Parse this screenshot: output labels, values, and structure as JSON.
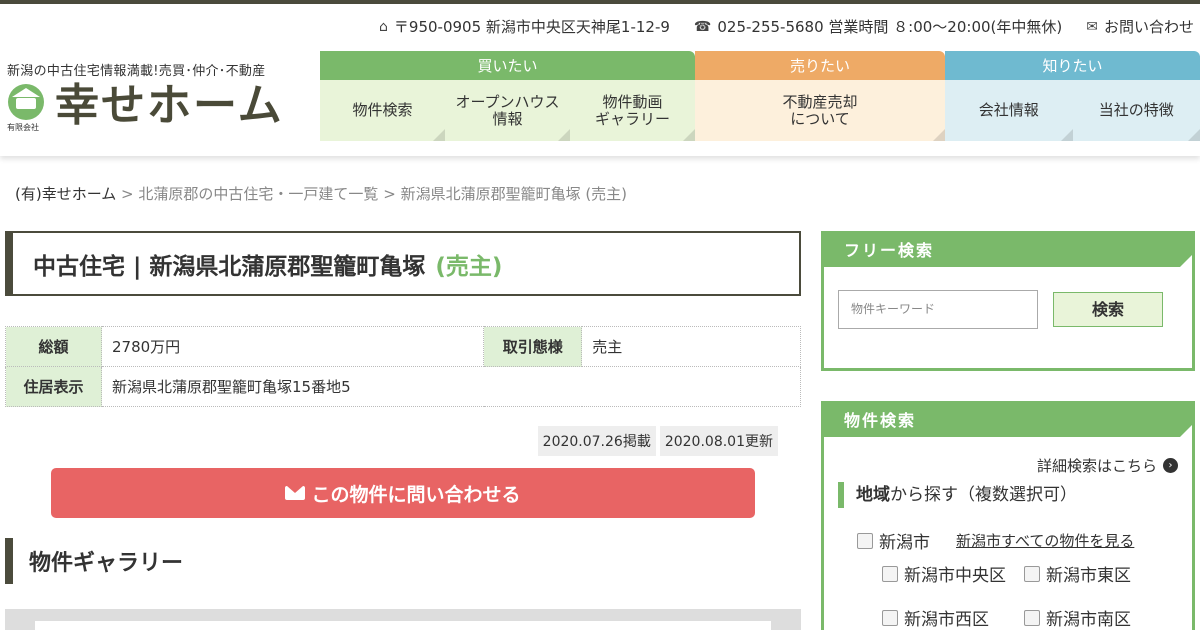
{
  "header": {
    "address": "〒950-0905 新潟市中央区天神尾1-12-9",
    "phone": "025-255-5680 営業時間 ８:00～20:00(年中無休)",
    "contact": "お問い合わせ",
    "tagline": "新潟の中古住宅情報満載!売買･仲介･不動産",
    "logo_small": "有限会社",
    "logo_text": "幸せホーム"
  },
  "nav": {
    "buy": {
      "head": "買いたい",
      "color": "#7ab96a",
      "bg": "#e9f4d9",
      "items": [
        "物件検索",
        "オープンハウス\n情報",
        "物件動画\nギャラリー"
      ]
    },
    "sell": {
      "head": "売りたい",
      "color": "#eeaa66",
      "bg": "#fdf0dc",
      "items": [
        "不動産売却\nについて"
      ]
    },
    "know": {
      "head": "知りたい",
      "color": "#6fbad0",
      "bg": "#ddeef3",
      "items": [
        "会社情報",
        "当社の特徴"
      ]
    }
  },
  "breadcrumb": {
    "home": "(有)幸せホーム",
    "level1": "北蒲原郡の中古住宅・一戸建て一覧",
    "level2": "新潟県北蒲原郡聖籠町亀塚 (売主)",
    "sep": ">"
  },
  "property": {
    "title": "中古住宅 | 新潟県北蒲原郡聖籠町亀塚",
    "title_sub": "(売主)",
    "price_label": "総額",
    "price_value": "2780万円",
    "deal_label": "取引態様",
    "deal_value": "売主",
    "address_label": "住居表示",
    "address_value": "新潟県北蒲原郡聖籠町亀塚15番地5",
    "posted": "2020.07.26掲載",
    "updated": "2020.08.01更新",
    "inquiry": "この物件に問い合わせる",
    "gallery_heading": "物件ギャラリー"
  },
  "sidebar": {
    "free_search_head": "フリー検索",
    "keyword_placeholder": "物件キーワード",
    "search_button": "検索",
    "property_search_head": "物件検索",
    "detail_link": "詳細検索はこちら",
    "area_bold": "地域",
    "area_rest": "から探す（複数選択可）",
    "city": "新潟市",
    "city_all_link": "新潟市すべての物件を見る",
    "wards": [
      "新潟市中央区",
      "新潟市東区",
      "新潟市西区",
      "新潟市南区"
    ]
  }
}
